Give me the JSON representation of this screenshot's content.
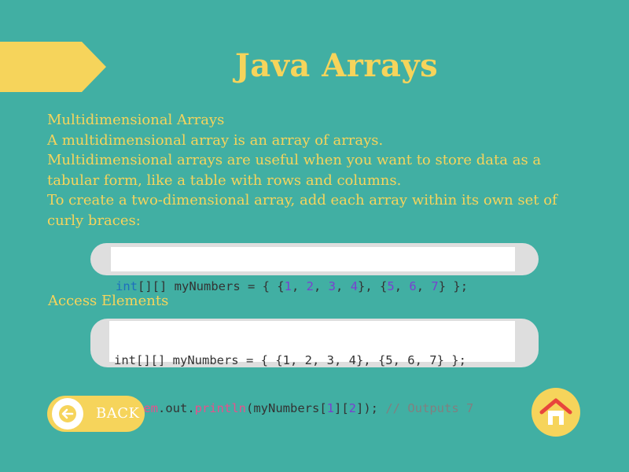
{
  "header": {
    "title": "Java Arrays"
  },
  "intro": {
    "lines": [
      "Multidimensional Arrays",
      "A multidimensional array is an array of arrays.",
      "Multidimensional arrays are useful when you want to store data as a",
      "tabular form, like a table with rows and columns.",
      "To create a two-dimensional array, add each array within its own set of",
      "curly braces:"
    ]
  },
  "code1": {
    "tokens": [
      {
        "t": "int",
        "c": "kw"
      },
      {
        "t": "[][] myNumbers = { {",
        "c": ""
      },
      {
        "t": "1",
        "c": "num"
      },
      {
        "t": ", ",
        "c": ""
      },
      {
        "t": "2",
        "c": "num"
      },
      {
        "t": ", ",
        "c": ""
      },
      {
        "t": "3",
        "c": "num"
      },
      {
        "t": ", ",
        "c": ""
      },
      {
        "t": "4",
        "c": "num"
      },
      {
        "t": "}, {",
        "c": ""
      },
      {
        "t": "5",
        "c": "num"
      },
      {
        "t": ", ",
        "c": ""
      },
      {
        "t": "6",
        "c": "num"
      },
      {
        "t": ", ",
        "c": ""
      },
      {
        "t": "7",
        "c": "num"
      },
      {
        "t": "} };",
        "c": ""
      }
    ]
  },
  "access": {
    "title": "Access Elements"
  },
  "code2": {
    "line1": "int[][] myNumbers = { {1, 2, 3, 4}, {5, 6, 7} };",
    "line2_tokens": [
      {
        "t": "System",
        "c": "sys"
      },
      {
        "t": ".out.",
        "c": ""
      },
      {
        "t": "println",
        "c": "sys"
      },
      {
        "t": "(myNumbers[",
        "c": ""
      },
      {
        "t": "1",
        "c": "num"
      },
      {
        "t": "][",
        "c": ""
      },
      {
        "t": "2",
        "c": "num"
      },
      {
        "t": "]); ",
        "c": ""
      },
      {
        "t": "// Outputs 7",
        "c": "cm"
      }
    ]
  },
  "nav": {
    "back_label": "BACK",
    "back_icon": "arrow-left-icon",
    "home_icon": "home-icon"
  },
  "colors": {
    "background": "#41afa3",
    "accent": "#f6d45b",
    "home_roof": "#e8453c"
  }
}
